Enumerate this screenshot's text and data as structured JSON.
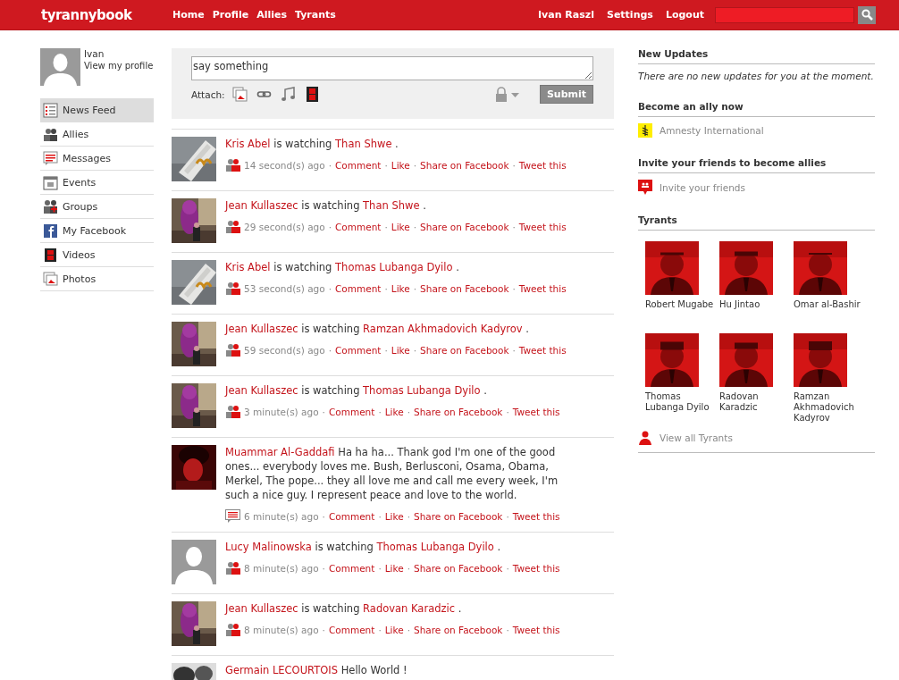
{
  "header": {
    "logo": "tyrannybook",
    "nav": [
      "Home",
      "Profile",
      "Allies",
      "Tyrants"
    ],
    "user_links": [
      "Ivan Raszl",
      "Settings",
      "Logout"
    ]
  },
  "profile": {
    "name": "Ivan",
    "link": "View my profile"
  },
  "sidebar": {
    "items": [
      {
        "label": "News Feed",
        "selected": true
      },
      {
        "label": "Allies",
        "selected": false
      },
      {
        "label": "Messages",
        "selected": false
      },
      {
        "label": "Events",
        "selected": false
      },
      {
        "label": "Groups",
        "selected": false
      },
      {
        "label": "My Facebook",
        "selected": false
      },
      {
        "label": "Videos",
        "selected": false
      },
      {
        "label": "Photos",
        "selected": false
      }
    ]
  },
  "composer": {
    "value": "say something",
    "attach_label": "Attach:",
    "submit": "Submit"
  },
  "feed": {
    "separator": "·",
    "items": [
      {
        "kind": "watching",
        "author": "Kris Abel",
        "verb": "is watching",
        "target": "Than Shwe",
        "end": ".",
        "time": "14 second(s) ago",
        "actions": [
          "Comment",
          "Like",
          "Share on Facebook",
          "Tweet this"
        ]
      },
      {
        "kind": "watching",
        "author": "Jean Kullaszec",
        "verb": "is watching",
        "target": "Than Shwe",
        "end": ".",
        "time": "29 second(s) ago",
        "actions": [
          "Comment",
          "Like",
          "Share on Facebook",
          "Tweet this"
        ]
      },
      {
        "kind": "watching",
        "author": "Kris Abel",
        "verb": "is watching",
        "target": "Thomas Lubanga Dyilo",
        "end": ".",
        "time": "53 second(s) ago",
        "actions": [
          "Comment",
          "Like",
          "Share on Facebook",
          "Tweet this"
        ]
      },
      {
        "kind": "watching",
        "author": "Jean Kullaszec",
        "verb": "is watching",
        "target": "Ramzan Akhmadovich Kadyrov",
        "end": ".",
        "time": "59 second(s) ago",
        "actions": [
          "Comment",
          "Like",
          "Share on Facebook",
          "Tweet this"
        ]
      },
      {
        "kind": "watching",
        "author": "Jean Kullaszec",
        "verb": "is watching",
        "target": "Thomas Lubanga Dyilo",
        "end": ".",
        "time": "3 minute(s) ago",
        "actions": [
          "Comment",
          "Like",
          "Share on Facebook",
          "Tweet this"
        ]
      },
      {
        "kind": "status",
        "author": "Muammar Al-Gaddafi",
        "text": "Ha ha ha... Thank god I'm one of the good ones... everybody loves me. Bush, Berlusconi, Osama, Obama, Merkel, The pope... they all love me and call me every week, I'm such a nice guy. I represent peace and love to the world.",
        "time": "6 minute(s) ago",
        "actions": [
          "Comment",
          "Like",
          "Share on Facebook",
          "Tweet this"
        ]
      },
      {
        "kind": "watching",
        "author": "Lucy Malinowska",
        "verb": "is watching",
        "target": "Thomas Lubanga Dyilo",
        "end": ".",
        "time": "8 minute(s) ago",
        "actions": [
          "Comment",
          "Like",
          "Share on Facebook",
          "Tweet this"
        ]
      },
      {
        "kind": "watching",
        "author": "Jean Kullaszec",
        "verb": "is watching",
        "target": "Radovan Karadzic",
        "end": ".",
        "time": "8 minute(s) ago",
        "actions": [
          "Comment",
          "Like",
          "Share on Facebook",
          "Tweet this"
        ]
      },
      {
        "kind": "status",
        "author": "Germain LECOURTOIS",
        "text": "Hello World !"
      }
    ]
  },
  "right": {
    "updates": {
      "title": "New Updates",
      "message": "There are no new updates for you at the moment."
    },
    "ally": {
      "title": "Become an ally now",
      "link": "Amnesty International"
    },
    "invite": {
      "title": "Invite your friends to become allies",
      "link": "Invite your friends"
    },
    "tyrants": {
      "title": "Tyrants",
      "names": [
        "Robert Mugabe",
        "Hu Jintao",
        "Omar al-Bashir",
        "Thomas Lubanga Dyilo",
        "Radovan Karadzic",
        "Ramzan Akhmadovich Kadyrov"
      ],
      "link": "View all Tyrants"
    }
  }
}
